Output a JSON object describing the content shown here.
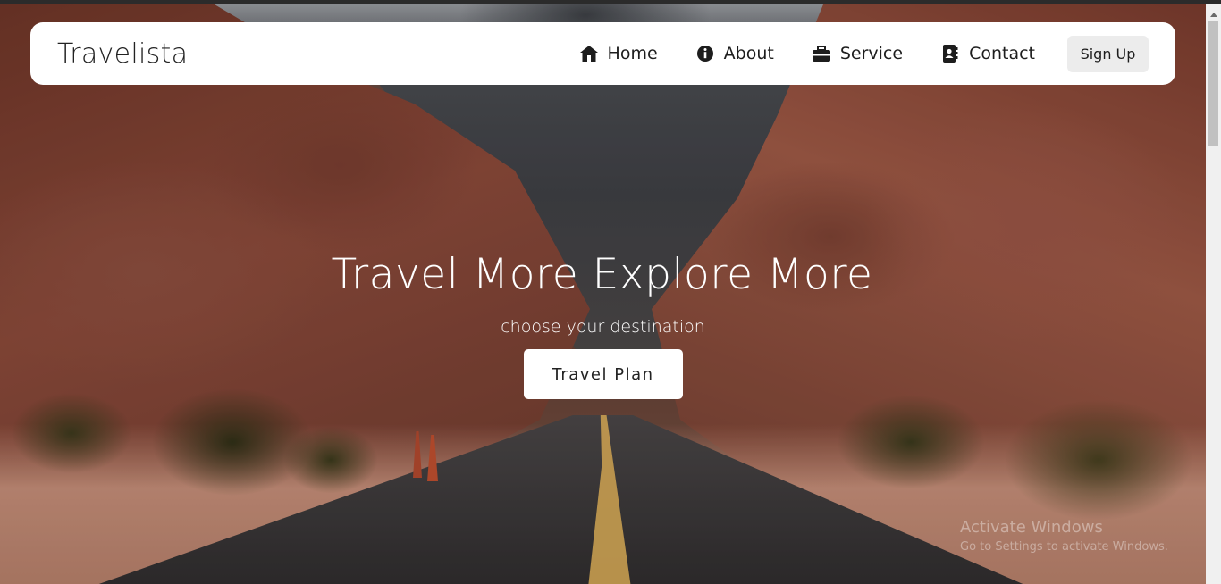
{
  "navbar": {
    "brand": "Travelista",
    "items": [
      {
        "label": "Home",
        "icon": "home-icon"
      },
      {
        "label": "About",
        "icon": "info-icon"
      },
      {
        "label": "Service",
        "icon": "briefcase-icon"
      },
      {
        "label": "Contact",
        "icon": "contact-book-icon"
      }
    ],
    "signup_label": "Sign Up"
  },
  "hero": {
    "headline": "Travel More Explore More",
    "subline": "choose your destination",
    "cta_label": "Travel Plan"
  },
  "watermark": {
    "line1": "Activate Windows",
    "line2": "Go to Settings to activate Windows."
  },
  "colors": {
    "navbar_bg": "#ffffff",
    "text_dark": "#1d1d1d",
    "signup_bg": "#ececec",
    "hero_text": "#ffffff"
  }
}
